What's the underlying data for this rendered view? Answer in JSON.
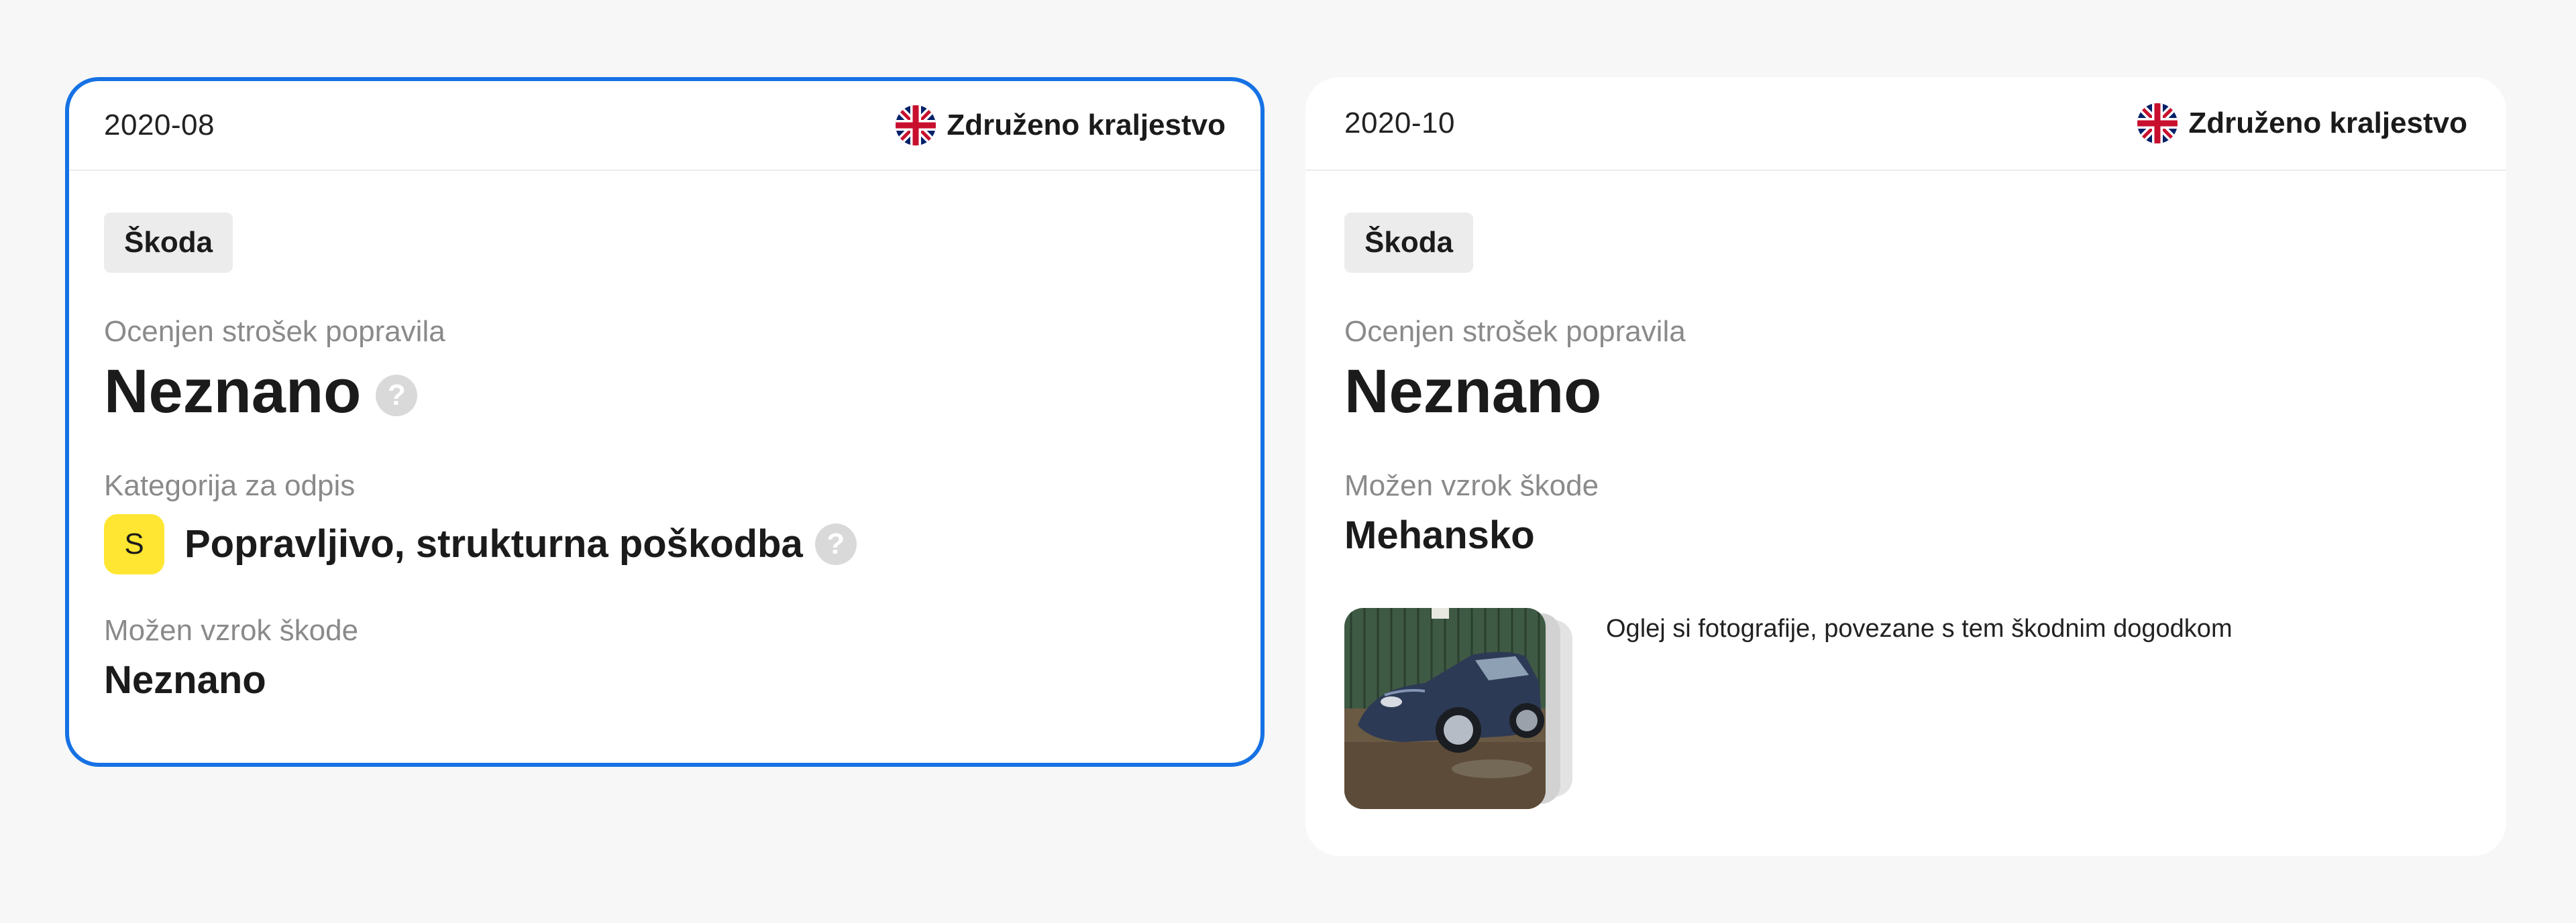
{
  "cards": [
    {
      "date": "2020-08",
      "country": "Združeno kraljestvo",
      "flag_icon": "uk-flag-icon",
      "brand_tag": "Škoda",
      "repair_cost_label": "Ocenjen strošek popravila",
      "repair_cost_value": "Neznano",
      "writeoff_label": "Kategorija za odpis",
      "writeoff_badge": "S",
      "writeoff_value": "Popravljivo, strukturna poškodba",
      "damage_cause_label": "Možen vzrok škode",
      "damage_cause_value": "Neznano",
      "selected": true
    },
    {
      "date": "2020-10",
      "country": "Združeno kraljestvo",
      "flag_icon": "uk-flag-icon",
      "brand_tag": "Škoda",
      "repair_cost_label": "Ocenjen strošek popravila",
      "repair_cost_value": "Neznano",
      "damage_cause_label": "Možen vzrok škode",
      "damage_cause_value": "Mehansko",
      "photos_caption": "Oglej si fotografije, povezane s tem škodnim dogodkom",
      "selected": false
    }
  ],
  "help_glyph": "?",
  "colors": {
    "selected_border": "#1672e4",
    "badge_s": "#ffe632",
    "background": "#f7f7f7",
    "card": "#ffffff"
  }
}
